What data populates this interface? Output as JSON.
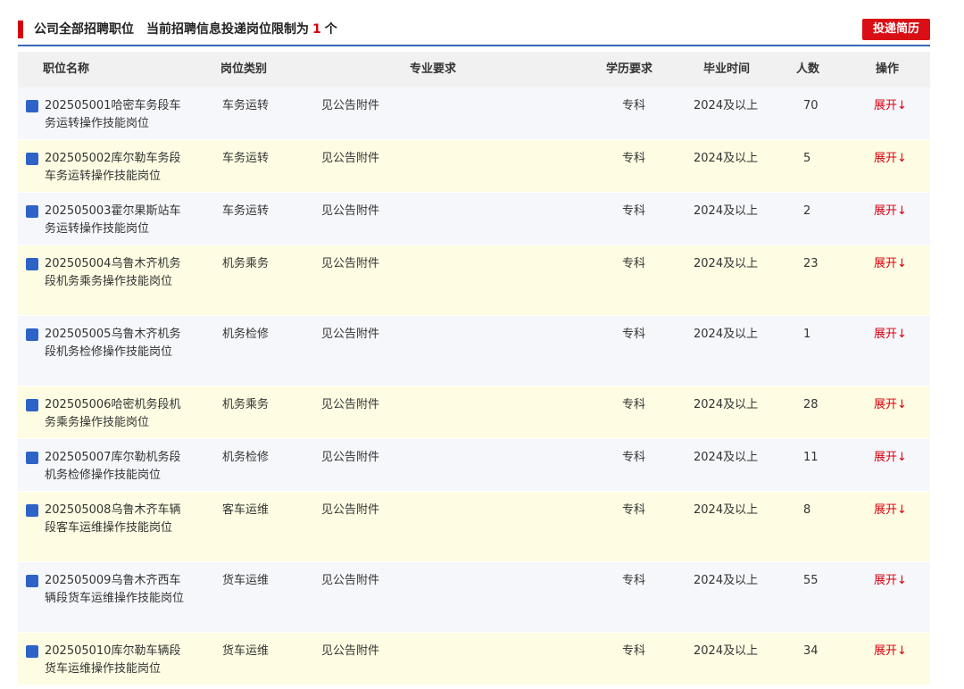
{
  "header": {
    "title_prefix": "公司全部招聘职位",
    "limit_text_before": "当前招聘信息投递岗位限制为",
    "limit_number": "1",
    "limit_text_after": "个",
    "submit_button": "投递简历"
  },
  "columns": [
    "职位名称",
    "岗位类别",
    "专业要求",
    "学历要求",
    "毕业时间",
    "人数",
    "操作"
  ],
  "rows": [
    {
      "name": "202505001哈密车务段车务运转操作技能岗位",
      "category": "车务运转",
      "major": "见公告附件",
      "education": "专科",
      "graduation": "2024及以上",
      "count": "70",
      "action": "展开↓"
    },
    {
      "name": "202505002库尔勒车务段车务运转操作技能岗位",
      "category": "车务运转",
      "major": "见公告附件",
      "education": "专科",
      "graduation": "2024及以上",
      "count": "5",
      "action": "展开↓"
    },
    {
      "name": "202505003霍尔果斯站车务运转操作技能岗位",
      "category": "车务运转",
      "major": "见公告附件",
      "education": "专科",
      "graduation": "2024及以上",
      "count": "2",
      "action": "展开↓"
    },
    {
      "name": "202505004乌鲁木齐机务段机务乘务操作技能岗位",
      "category": "机务乘务",
      "major": "见公告附件",
      "education": "专科",
      "graduation": "2024及以上",
      "count": "23",
      "action": "展开↓"
    },
    {
      "name": "202505005乌鲁木齐机务段机务检修操作技能岗位",
      "category": "机务检修",
      "major": "见公告附件",
      "education": "专科",
      "graduation": "2024及以上",
      "count": "1",
      "action": "展开↓"
    },
    {
      "name": "202505006哈密机务段机务乘务操作技能岗位",
      "category": "机务乘务",
      "major": "见公告附件",
      "education": "专科",
      "graduation": "2024及以上",
      "count": "28",
      "action": "展开↓"
    },
    {
      "name": "202505007库尔勒机务段机务检修操作技能岗位",
      "category": "机务检修",
      "major": "见公告附件",
      "education": "专科",
      "graduation": "2024及以上",
      "count": "11",
      "action": "展开↓"
    },
    {
      "name": "202505008乌鲁木齐车辆段客车运维操作技能岗位",
      "category": "客车运维",
      "major": "见公告附件",
      "education": "专科",
      "graduation": "2024及以上",
      "count": "8",
      "action": "展开↓"
    },
    {
      "name": "202505009乌鲁木齐西车辆段货车运维操作技能岗位",
      "category": "货车运维",
      "major": "见公告附件",
      "education": "专科",
      "graduation": "2024及以上",
      "count": "55",
      "action": "展开↓"
    },
    {
      "name": "202505010库尔勒车辆段货车运维操作技能岗位",
      "category": "货车运维",
      "major": "见公告附件",
      "education": "专科",
      "graduation": "2024及以上",
      "count": "34",
      "action": "展开↓"
    }
  ],
  "colors": {
    "accent_red": "#d8000f",
    "button_red": "#d90f16",
    "checkbox_blue": "#2d63c6",
    "row_odd": "#f6f7fb",
    "row_even": "#fefde3",
    "header_bg": "#f1f1f1",
    "rule_blue": "#3a66b8"
  },
  "icons": {
    "row_marker": "blue-square-checkbox",
    "title_marker": "red-vertical-bar"
  }
}
